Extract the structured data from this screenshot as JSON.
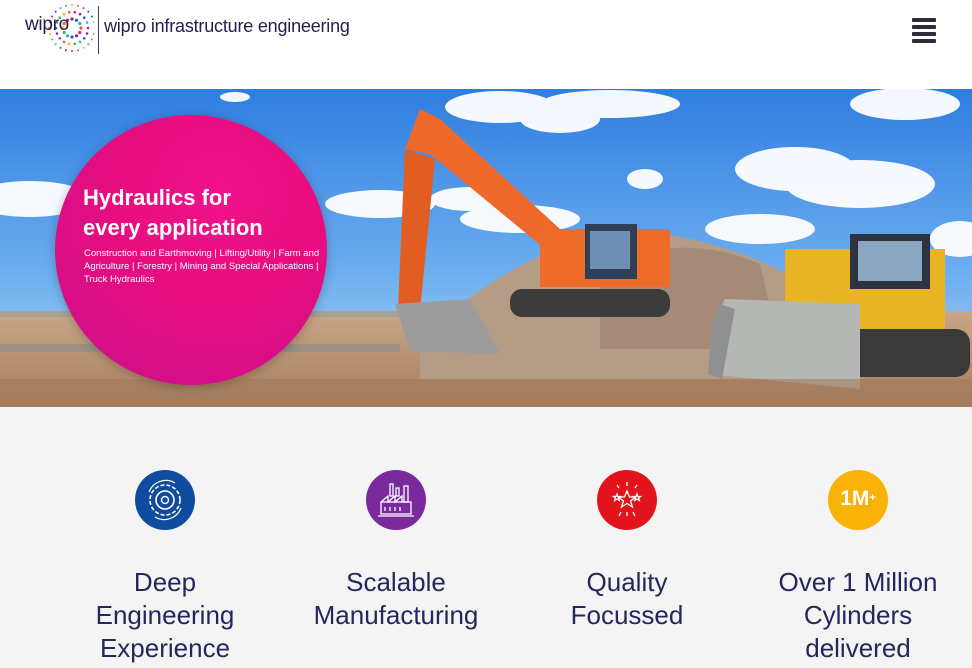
{
  "header": {
    "logo_text": "wipro",
    "brand_title": "wipro infrastructure engineering",
    "menu_icon": "hamburger-menu-icon"
  },
  "hero": {
    "title_line1": "Hydraulics for",
    "title_line2": "every application",
    "subtitle": "Construction and Earthmoving | Lifting/Utility | Farm and Agriculture | Forestry | Mining and Special Applications | Truck Hydraulics",
    "circle_color": "#e8117f"
  },
  "features": [
    {
      "icon": "gear-engineering-icon",
      "color": "#0f4c9e",
      "line1": "Deep",
      "line2": "Engineering",
      "line3": "Experience"
    },
    {
      "icon": "factory-icon",
      "color": "#7b2a9e",
      "line1": "Scalable",
      "line2": "Manufacturing",
      "line3": ""
    },
    {
      "icon": "quality-stars-icon",
      "color": "#e3131b",
      "line1": "Quality",
      "line2": "Focussed",
      "line3": ""
    },
    {
      "icon": "1m-plus-badge-icon",
      "color": "#f9b208",
      "badge": "1M",
      "badge_sup": "+",
      "line1": "Over 1 Million",
      "line2": "Cylinders",
      "line3": "delivered"
    }
  ]
}
